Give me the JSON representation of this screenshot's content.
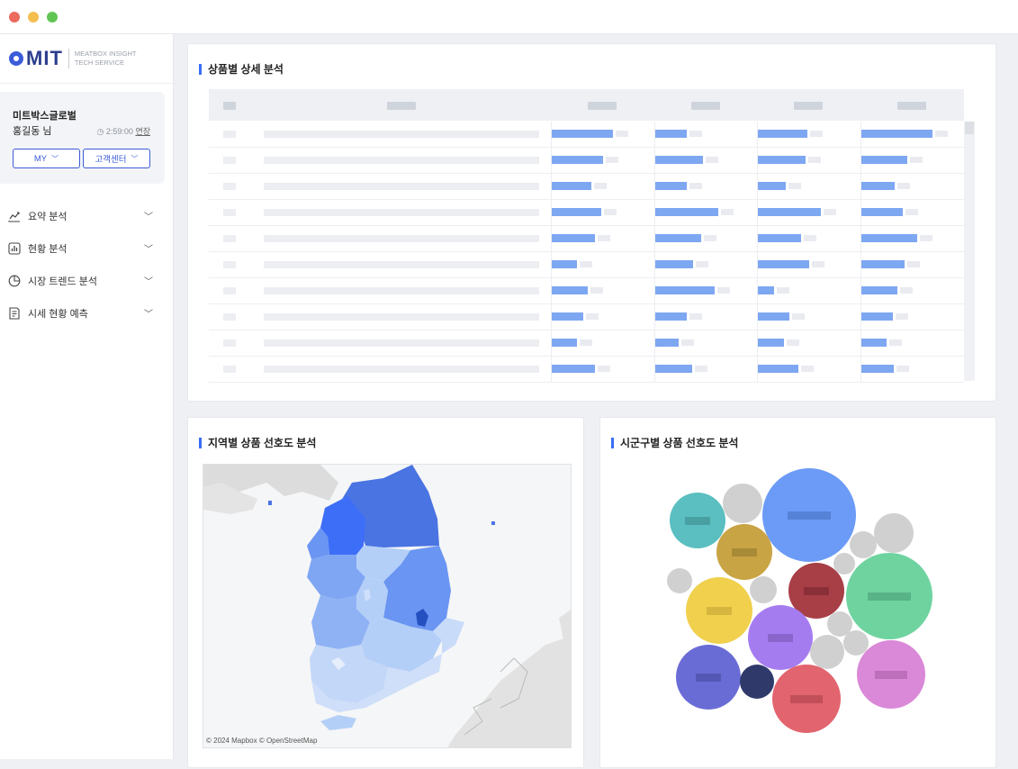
{
  "sidebar": {
    "logo": {
      "brand": "MIT",
      "sub_line1": "MEATBOX INSIGHT",
      "sub_line2": "TECH SERVICE"
    },
    "user": {
      "company": "미트박스글로벌",
      "name": "홍길동 님",
      "session_time": "2:59:00",
      "extend_label": "연장",
      "my_button": "MY",
      "support_button": "고객센터"
    },
    "nav": [
      {
        "label": "요약 분석",
        "icon": "trend-line-icon"
      },
      {
        "label": "현황 분석",
        "icon": "bar-chart-icon"
      },
      {
        "label": "시장 트렌드 분석",
        "icon": "pie-chart-icon"
      },
      {
        "label": "시세 현황 예측",
        "icon": "document-icon"
      }
    ]
  },
  "panels": {
    "product_detail": {
      "title": "상품별 상세 분석"
    },
    "region_pref": {
      "title": "지역별 상품 선호도 분석",
      "map_credit": "© 2024 Mapbox © OpenStreetMap"
    },
    "district_pref": {
      "title": "시군구별 상품 선호도 분석"
    }
  },
  "colors": {
    "accent": "#3b6cf5",
    "bar": "#7ea7f2",
    "placeholder": "#eceef2"
  },
  "table_fill": [
    [
      0.62,
      0.32,
      0.5,
      0.72
    ],
    [
      0.52,
      0.48,
      0.48,
      0.46
    ],
    [
      0.4,
      0.32,
      0.28,
      0.34
    ],
    [
      0.5,
      0.64,
      0.64,
      0.42
    ],
    [
      0.44,
      0.46,
      0.44,
      0.56
    ],
    [
      0.25,
      0.38,
      0.52,
      0.44
    ],
    [
      0.36,
      0.6,
      0.16,
      0.36
    ],
    [
      0.32,
      0.32,
      0.32,
      0.32
    ],
    [
      0.25,
      0.24,
      0.26,
      0.25
    ],
    [
      0.44,
      0.37,
      0.41,
      0.33
    ]
  ]
}
